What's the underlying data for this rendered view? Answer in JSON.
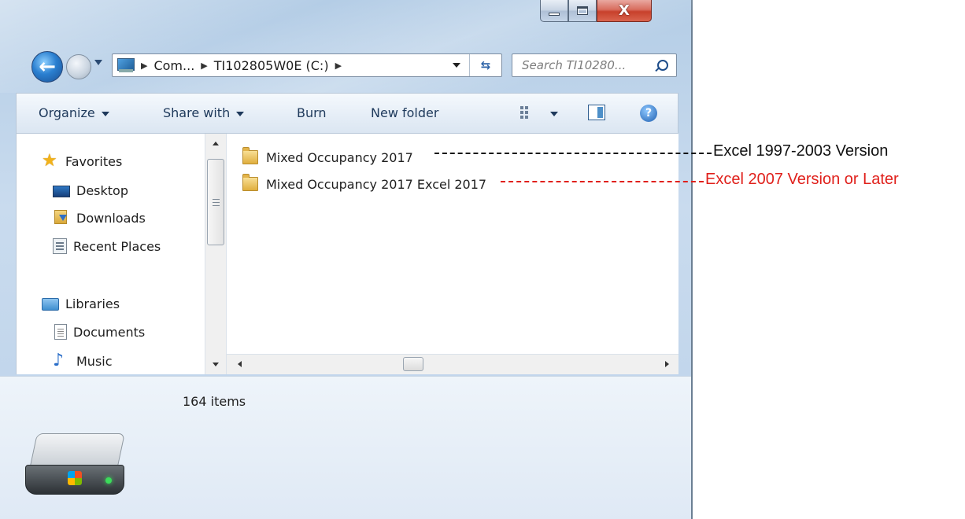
{
  "window": {
    "caption": {
      "minimize": "minimize",
      "maximize": "maximize",
      "close": "X"
    }
  },
  "address_bar": {
    "crumbs": [
      "Com...",
      "TI102805W0E (C:)"
    ]
  },
  "search": {
    "placeholder": "Search TI10280..."
  },
  "toolbar": {
    "organize": "Organize",
    "share_with": "Share with",
    "burn": "Burn",
    "new_folder": "New folder"
  },
  "nav_pane": {
    "favorites": "Favorites",
    "desktop": "Desktop",
    "downloads": "Downloads",
    "recent_places": "Recent Places",
    "libraries": "Libraries",
    "documents": "Documents",
    "music": "Music"
  },
  "files": [
    {
      "name": "Mixed Occupancy 2017"
    },
    {
      "name": "Mixed Occupancy 2017 Excel 2017"
    }
  ],
  "details": {
    "item_count": "164 items"
  },
  "annotations": [
    {
      "text": "Excel 1997-2003 Version",
      "color": "#111111"
    },
    {
      "text": "Excel 2007 Version or Later",
      "color": "#e0201b"
    }
  ]
}
